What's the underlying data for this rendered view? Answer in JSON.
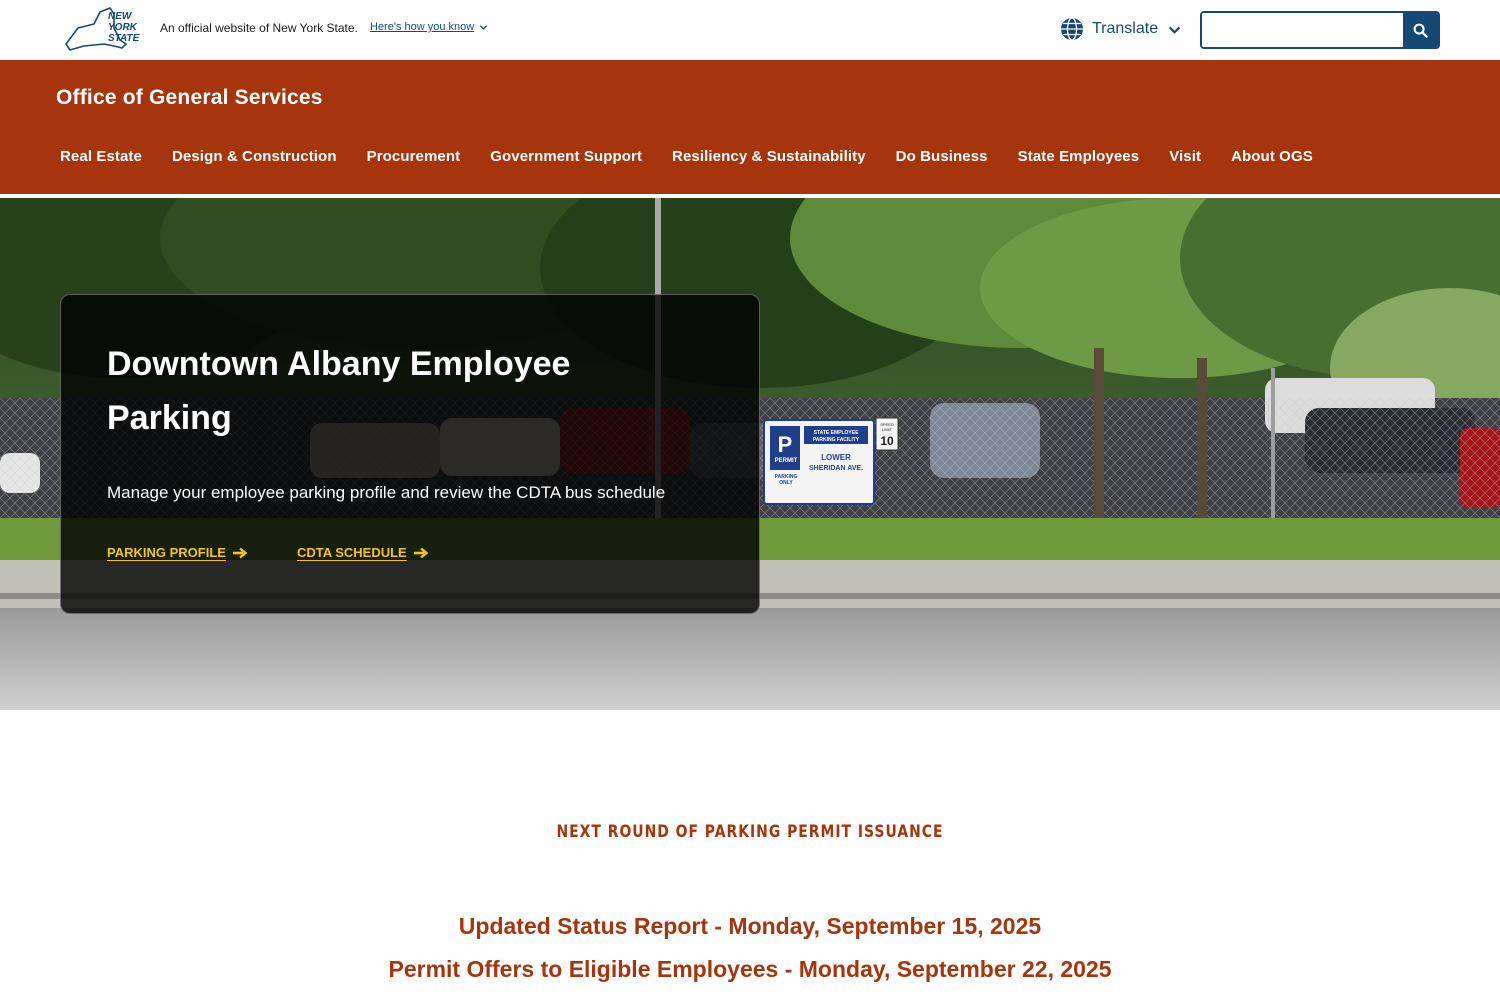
{
  "topbar": {
    "logo_lines": [
      "NEW",
      "YORK",
      "STATE"
    ],
    "official_text": "An official website of New York State.",
    "how_you_know": "Here's how you know",
    "translate_label": "Translate",
    "search_placeholder": "",
    "icons": {
      "logo": "nys-logo-icon",
      "chevron": "chevron-down-icon",
      "globe": "globe-icon",
      "search": "search-icon"
    },
    "colors": {
      "link": "#154973",
      "search_button": "#154973"
    }
  },
  "header": {
    "agency_name": "Office of General Services",
    "background": "#a6350e",
    "nav": [
      {
        "label": "Real Estate"
      },
      {
        "label": "Design & Construction"
      },
      {
        "label": "Procurement"
      },
      {
        "label": "Government Support"
      },
      {
        "label": "Resiliency & Sustainability"
      },
      {
        "label": "Do Business"
      },
      {
        "label": "State Employees"
      },
      {
        "label": "Visit"
      },
      {
        "label": "About OGS"
      }
    ]
  },
  "hero": {
    "title": "Downtown Albany Employee Parking",
    "subtitle": "Manage your employee parking profile and review the CDTA bus schedule",
    "links": [
      {
        "label": "PARKING PROFILE"
      },
      {
        "label": "CDTA SCHEDULE"
      }
    ],
    "link_color": "#f4c51c",
    "sign_lines": [
      "P",
      "PERMIT",
      "PARKING",
      "ONLY",
      "STATE EMPLOYEE",
      "PARKING FACILITY",
      "LOWER",
      "SHERIDAN AVE.",
      "SPEED",
      "LIMIT",
      "10"
    ]
  },
  "announcement": {
    "eyebrow": "NEXT ROUND OF PARKING PERMIT ISSUANCE",
    "lines": [
      "Updated Status Report - Monday, September 15, 2025",
      "Permit Offers to Eligible Employees - Monday, September 22, 2025"
    ],
    "color": "#a6350e"
  }
}
